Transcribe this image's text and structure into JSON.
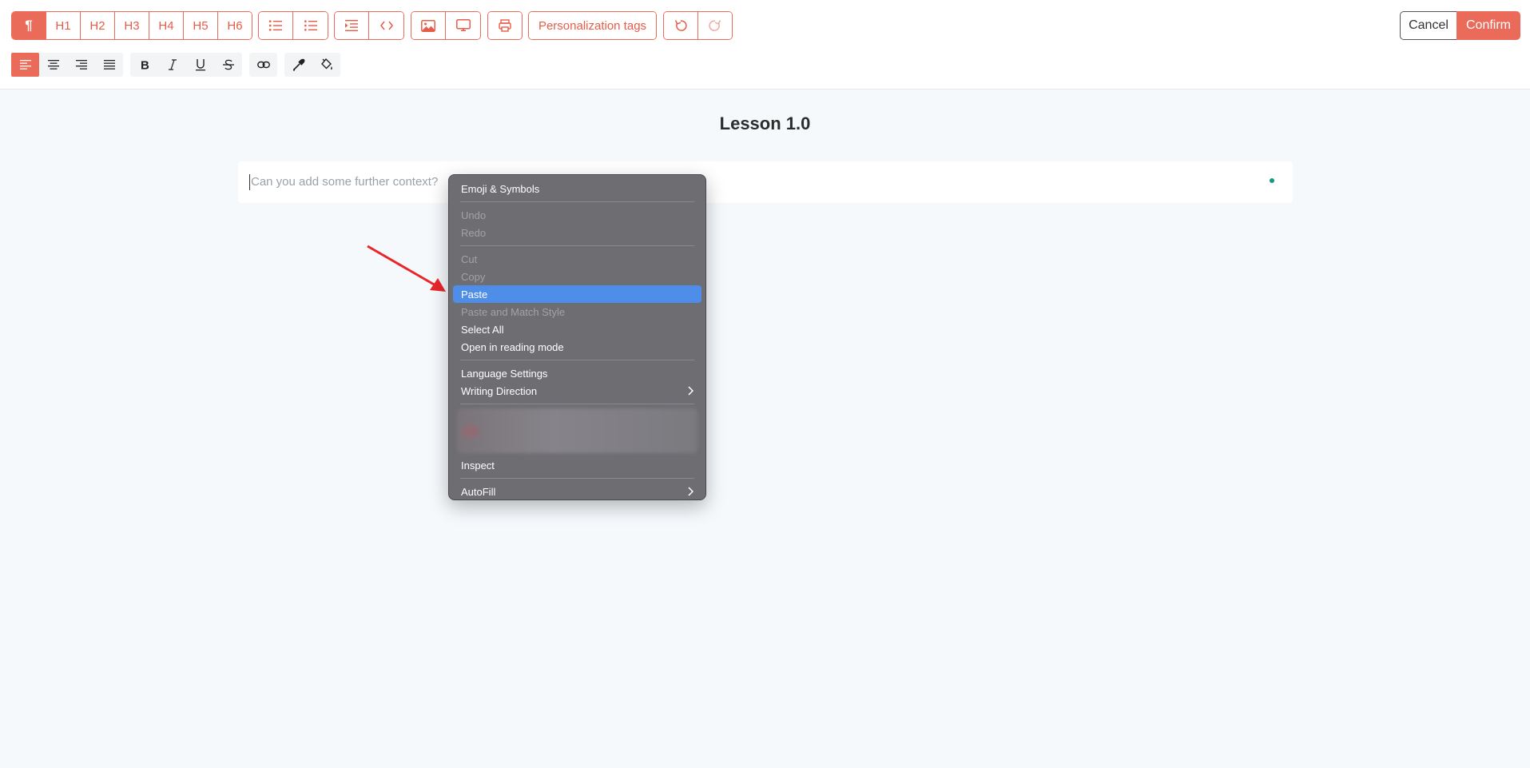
{
  "toolbar": {
    "headings": [
      "¶",
      "H1",
      "H2",
      "H3",
      "H4",
      "H5",
      "H6"
    ],
    "personalization_label": "Personalization tags",
    "cancel_label": "Cancel",
    "confirm_label": "Confirm",
    "accent_color": "#ea6b5a",
    "list_icons": [
      "ordered-list-icon",
      "unordered-list-icon"
    ],
    "block_icons": [
      "indent-icon",
      "code-icon"
    ],
    "media_icons": [
      "image-icon",
      "monitor-icon"
    ],
    "misc_icons": [
      "print-icon"
    ],
    "history_icons": [
      "undo-icon",
      "redo-icon"
    ],
    "format_icons": [
      "align-left-icon",
      "align-center-icon",
      "align-right-icon",
      "align-justify-icon",
      "bold-icon",
      "italic-icon",
      "underline-icon",
      "strikethrough-icon",
      "link-icon",
      "eyedropper-icon",
      "paint-bucket-icon"
    ]
  },
  "document": {
    "title": "Lesson 1.0",
    "placeholder": "Can you add some further context?"
  },
  "context_menu": {
    "items": [
      {
        "label": "Emoji & Symbols",
        "state": "enabled"
      },
      {
        "sep": true
      },
      {
        "label": "Undo",
        "state": "disabled"
      },
      {
        "label": "Redo",
        "state": "disabled"
      },
      {
        "sep": true
      },
      {
        "label": "Cut",
        "state": "disabled"
      },
      {
        "label": "Copy",
        "state": "disabled"
      },
      {
        "label": "Paste",
        "state": "highlight"
      },
      {
        "label": "Paste and Match Style",
        "state": "disabled"
      },
      {
        "label": "Select All",
        "state": "enabled"
      },
      {
        "label": "Open in reading mode",
        "state": "enabled"
      },
      {
        "sep": true
      },
      {
        "label": "Language Settings",
        "state": "enabled"
      },
      {
        "label": "Writing Direction",
        "state": "enabled",
        "submenu": true
      },
      {
        "sep": true
      },
      {
        "blurred": true
      },
      {
        "label": "Inspect",
        "state": "enabled"
      },
      {
        "sep": true
      },
      {
        "label": "AutoFill",
        "state": "enabled",
        "submenu": true
      }
    ],
    "highlight_color": "#4f8ee8"
  }
}
